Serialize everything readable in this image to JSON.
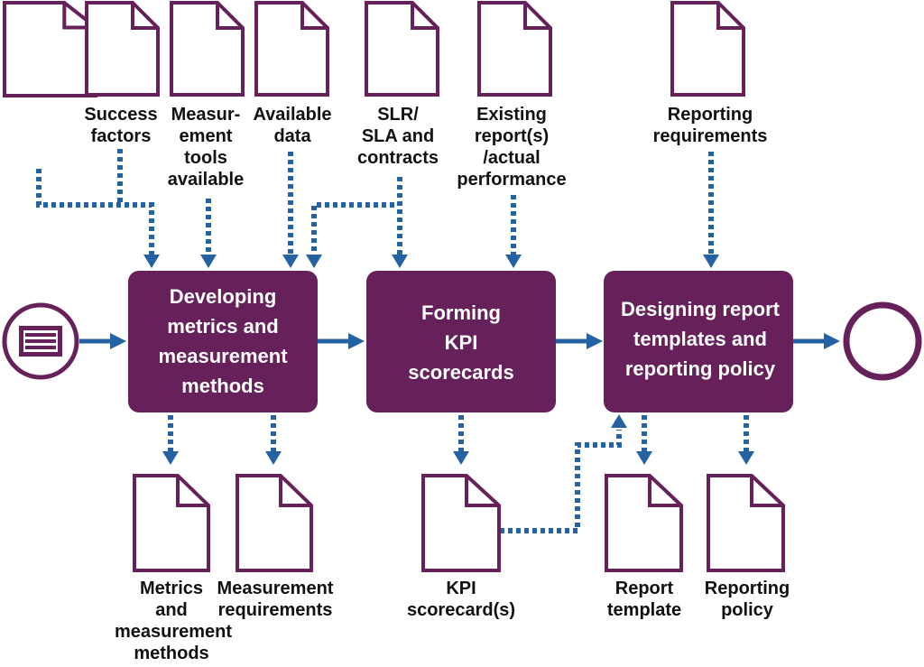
{
  "colors": {
    "process_fill": "#66205a",
    "document_stroke": "#66205a",
    "arrow": "#2462a3",
    "label_text": "#111111",
    "process_text": "#ffffff"
  },
  "start_event": {
    "icon": "message-icon"
  },
  "end_event": {
    "icon": "end-circle-icon"
  },
  "processes": [
    {
      "id": "p1",
      "lines": [
        "Developing",
        "metrics and",
        "measurement",
        "methods"
      ]
    },
    {
      "id": "p2",
      "lines": [
        "Forming",
        "KPI",
        "scorecards"
      ]
    },
    {
      "id": "p3",
      "lines": [
        "Designing report",
        "templates and",
        "reporting policy"
      ]
    }
  ],
  "inputs": [
    {
      "id": "in0",
      "lines": []
    },
    {
      "id": "in1",
      "lines": [
        "Success",
        "factors"
      ]
    },
    {
      "id": "in2",
      "lines": [
        "Measur-",
        "ement",
        "tools",
        "available"
      ]
    },
    {
      "id": "in3",
      "lines": [
        "Available",
        "data"
      ]
    },
    {
      "id": "in4",
      "lines": [
        "SLR/",
        "SLA and",
        "contracts"
      ]
    },
    {
      "id": "in5",
      "lines": [
        "Existing",
        "report(s)",
        "/actual",
        "performance"
      ]
    },
    {
      "id": "in6",
      "lines": [
        "Reporting",
        "requirements"
      ]
    }
  ],
  "outputs": [
    {
      "id": "out1",
      "lines": [
        "Metrics",
        "and",
        "measurement",
        "methods"
      ]
    },
    {
      "id": "out2",
      "lines": [
        "Measurement",
        "requirements"
      ]
    },
    {
      "id": "out3",
      "lines": [
        "KPI",
        "scorecard(s)"
      ]
    },
    {
      "id": "out4",
      "lines": [
        "Report",
        "template"
      ]
    },
    {
      "id": "out5",
      "lines": [
        "Reporting",
        "policy"
      ]
    }
  ]
}
